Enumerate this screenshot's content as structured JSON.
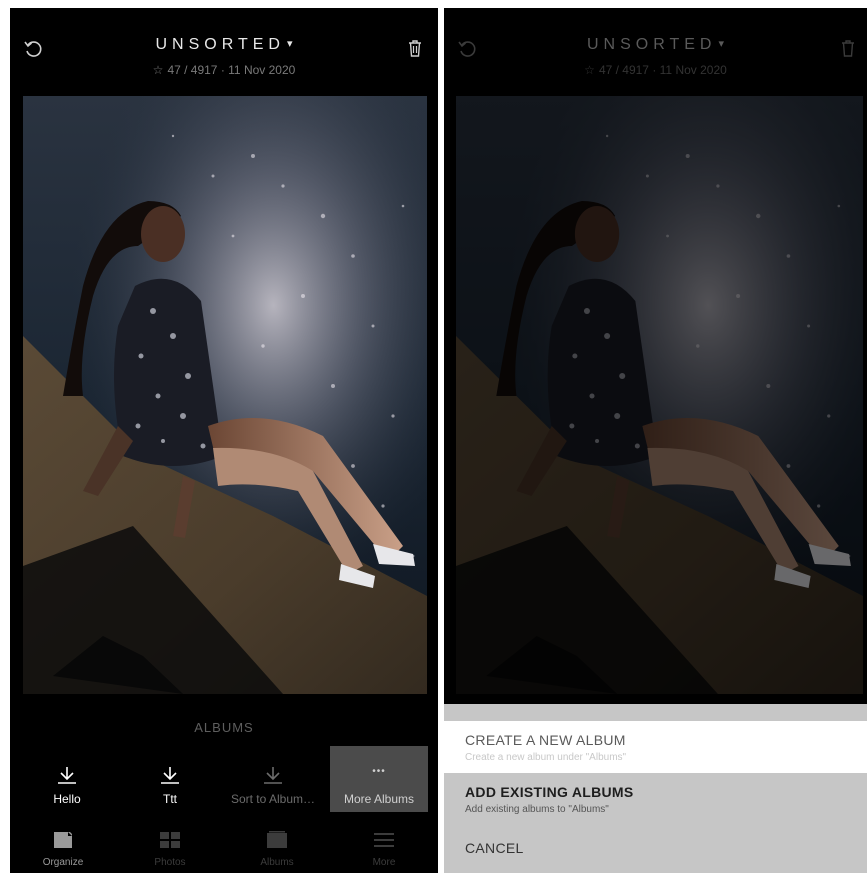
{
  "header": {
    "title": "UNSORTED",
    "caret": "▾",
    "star": "☆",
    "subtitle": "47 / 4917 · 11 Nov 2020",
    "undo_icon": "undo-icon",
    "trash_icon": "trash-icon"
  },
  "albums": {
    "heading": "ALBUMS",
    "buttons": [
      {
        "label": "Hello",
        "icon": "download-icon"
      },
      {
        "label": "Ttt",
        "icon": "download-icon"
      },
      {
        "label": "Sort to Album…",
        "icon": "download-icon"
      },
      {
        "label": "More Albums",
        "icon": "ellipsis-icon",
        "glyph": "•••"
      }
    ]
  },
  "tabs": [
    {
      "label": "Organize",
      "icon": "organize-icon",
      "selected": true
    },
    {
      "label": "Photos",
      "icon": "grid-icon"
    },
    {
      "label": "Albums",
      "icon": "albums-icon"
    },
    {
      "label": "More",
      "icon": "menu-icon"
    }
  ],
  "sheet": {
    "create": {
      "title": "CREATE A NEW ALBUM",
      "subtitle": "Create a new album under \"Albums\""
    },
    "add": {
      "title": "ADD EXISTING ALBUMS",
      "subtitle": "Add existing albums to \"Albums\""
    },
    "cancel": {
      "title": "CANCEL"
    }
  },
  "colors": {
    "background": "#000000",
    "sheet": "#c6c6c6",
    "highlight": "#ffffff",
    "active_button": "#4b4b4b"
  }
}
